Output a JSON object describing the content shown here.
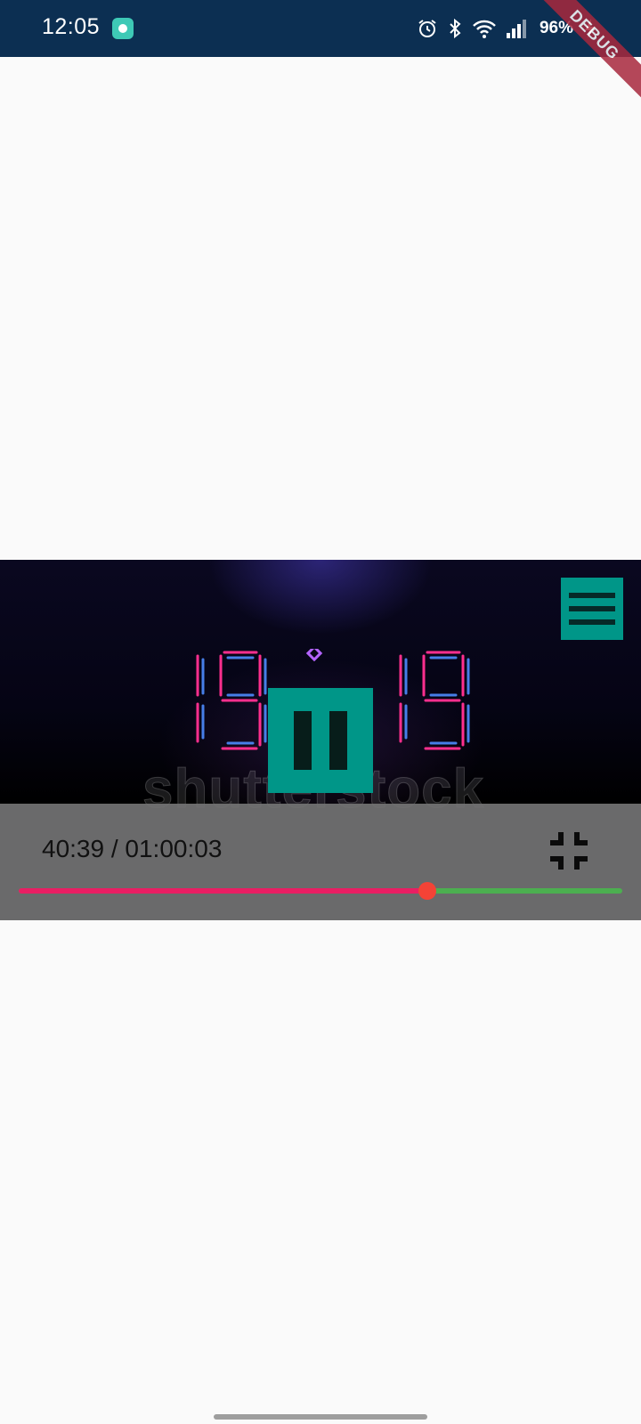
{
  "status_bar": {
    "time": "12:05",
    "battery": "96%",
    "icons": [
      "app-notification-icon",
      "alarm-icon",
      "bluetooth-icon",
      "wifi-icon",
      "signal-icon",
      "battery-charging-icon"
    ],
    "background": "#0c2f52",
    "debug_banner": "DEBUG"
  },
  "video_player": {
    "clock_reading": "19:19",
    "watermark": "shutterstock",
    "time_display": "40:39 / 01:00:03",
    "progress_fraction": 0.6765,
    "colors": {
      "accent": "#009688",
      "played": "#e91e63",
      "remaining": "#4caf50",
      "thumb": "#f44336"
    },
    "icons": {
      "menu": "menu-icon",
      "pause": "pause-icon",
      "exit_fullscreen": "fullscreen-exit-icon"
    }
  }
}
